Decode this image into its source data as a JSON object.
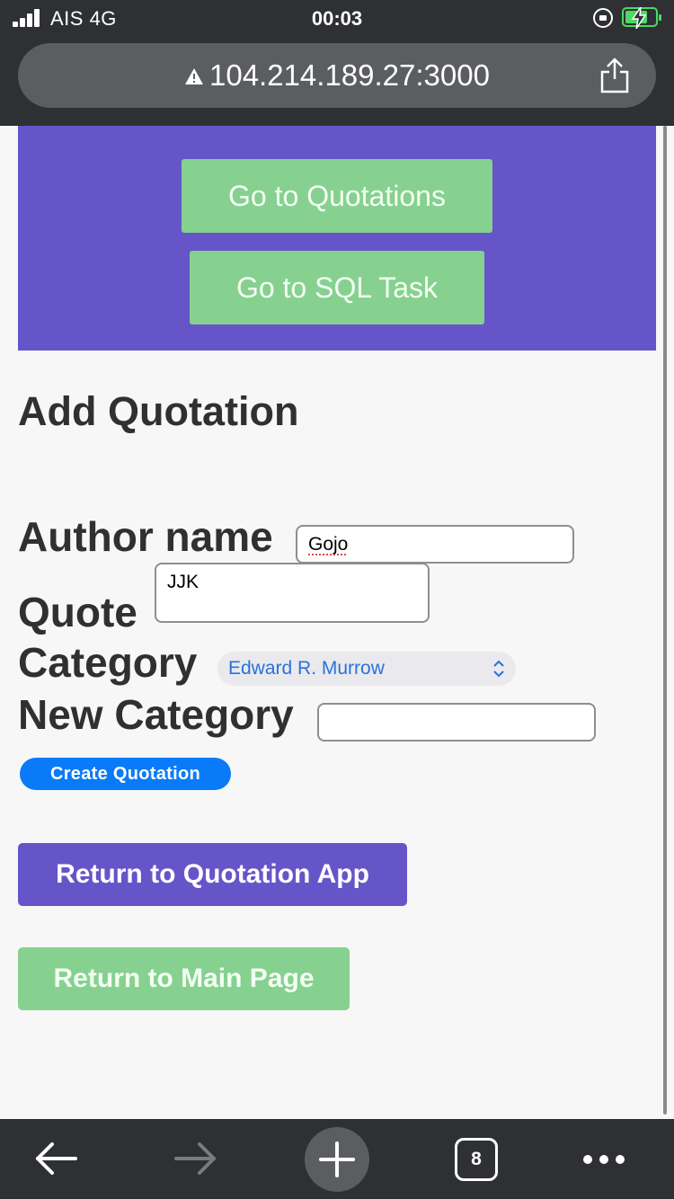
{
  "status_bar": {
    "carrier": "AIS  4G",
    "time": "00:03"
  },
  "browser": {
    "url": "104.214.189.27:3000",
    "tab_count": "8"
  },
  "nav": {
    "quotations_button": "Go to Quotations",
    "sql_button": "Go to SQL Task"
  },
  "form": {
    "title": "Add Quotation",
    "author_label": "Author name",
    "author_value": "Gojo",
    "quote_label": "Quote",
    "quote_value": "JJK",
    "category_label": "Category",
    "category_selected": "Edward R. Murrow",
    "new_category_label": "New Category",
    "new_category_value": "",
    "submit_label": "Create Quotation"
  },
  "links": {
    "return_app": "Return to Quotation App",
    "return_main": "Return to Main Page"
  },
  "colors": {
    "purple": "#6655c9",
    "green": "#86d18f",
    "blue": "#0a7bf8"
  }
}
